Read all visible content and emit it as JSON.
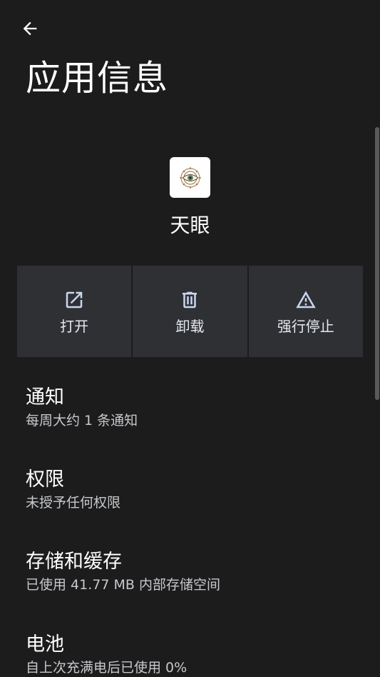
{
  "header": {
    "title": "应用信息"
  },
  "app": {
    "name": "天眼"
  },
  "actions": [
    {
      "label": "打开",
      "icon": "open-external-icon"
    },
    {
      "label": "卸载",
      "icon": "trash-icon"
    },
    {
      "label": "强行停止",
      "icon": "warning-icon"
    }
  ],
  "settings": [
    {
      "title": "通知",
      "subtitle": "每周大约 1 条通知"
    },
    {
      "title": "权限",
      "subtitle": "未授予任何权限"
    },
    {
      "title": "存储和缓存",
      "subtitle": "已使用 41.77 MB 内部存储空间"
    },
    {
      "title": "电池",
      "subtitle": "自上次充满电后已使用 0%"
    }
  ],
  "colors": {
    "background": "#1c1c1d",
    "action_tile": "#2e3034",
    "icon_tint": "#c9d6ef",
    "subtitle": "#c6c8cc"
  }
}
